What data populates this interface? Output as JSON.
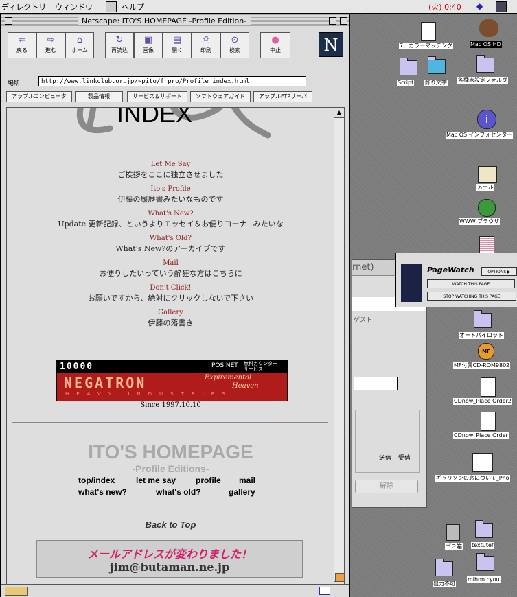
{
  "menubar": {
    "items": [
      "ディレクトリ",
      "ウィンドウ",
      "ヘルプ"
    ],
    "clock": "(火) 0:40"
  },
  "window": {
    "title": "Netscape: ITO'S HOMEPAGE -Profile Edition-"
  },
  "toolbar": {
    "buttons": [
      "戻る",
      "進む",
      "ホーム",
      "再読込",
      "画像",
      "開く",
      "印刷",
      "検索",
      "中止"
    ],
    "logo": "N"
  },
  "location": {
    "label": "場所:",
    "url": "http://www.linkclub.or.jp/~pito/f_pro/Profile_index.html"
  },
  "directory_buttons": [
    "アップルコンピュータ",
    "製品情報",
    "サービス＆サポート",
    "ソフトウェアガイド",
    "アップルFTPサーバ"
  ],
  "page": {
    "index_title": "INDEX",
    "nav": [
      {
        "link": "Let Me Say",
        "desc": "ご挨拶をここに独立させました"
      },
      {
        "link": "Ito's Profile",
        "desc": "伊藤の履歴書みたいなものです"
      },
      {
        "link": "What's New?",
        "desc": "Update 更新記録、というよりエッセイ＆お便りコーナ−みたいな"
      },
      {
        "link": "What's Old?",
        "desc": "What's New?のアーカイブです"
      },
      {
        "link": "Mail",
        "desc": "お便りしたいっていう酔狂な方はこちらに"
      },
      {
        "link": "Don't Click!",
        "desc": "お願いですから、絶対にクリックしないで下さい"
      },
      {
        "link": "Gallery",
        "desc": "伊藤の落書き"
      }
    ],
    "counter": {
      "number": "10000",
      "posinet": "POSINET",
      "free_line1": "無料カウンター",
      "free_line2": "サービス",
      "brand": "NEGATRON",
      "tag1": "Expiremental",
      "tag2": "Heaven",
      "industries": "HEAVY INDUSTRIES"
    },
    "since": "Since 1997.10.10",
    "footer_title": "ITO'S HOMEPAGE",
    "footer_subtitle": "-Profile Editions-",
    "footer_nav_row1": [
      "top/index",
      "let me say",
      "profile",
      "mail"
    ],
    "footer_nav_row2": [
      "what's new?",
      "what's old?",
      "gallery"
    ],
    "back_to_top": "Back to Top",
    "mail_notice": "メールアドレスが変わりました！",
    "mail_address": "jim@butaman.ne.jp"
  },
  "desktop": {
    "icons": [
      "7．カラーマッチング",
      "Mac OS HD",
      "Script",
      "飾り文字",
      "各種末設定フォルダ",
      "Mac OS インフォセンター",
      "メール",
      "WWW ブラウザ",
      "オートパイロット",
      "MF付属CD-ROM9802",
      "CDnow_Place Order2",
      "CDnow_Place Order",
      "ギャリソンの窓について_Pho",
      "ゴミ箱",
      "textutef",
      "出力不可",
      "mihon cyou"
    ],
    "bg_window": {
      "title_fragment": "rnet)",
      "guest": "ゲスト",
      "send": "送信",
      "receive": "受信",
      "cancel": "解除"
    }
  },
  "pagewatch": {
    "title": "PageWatch",
    "options": "OPTIONS ▶",
    "watch": "WATCH THIS PAGE",
    "stop": "STOP WATCHING THIS PAGE"
  }
}
